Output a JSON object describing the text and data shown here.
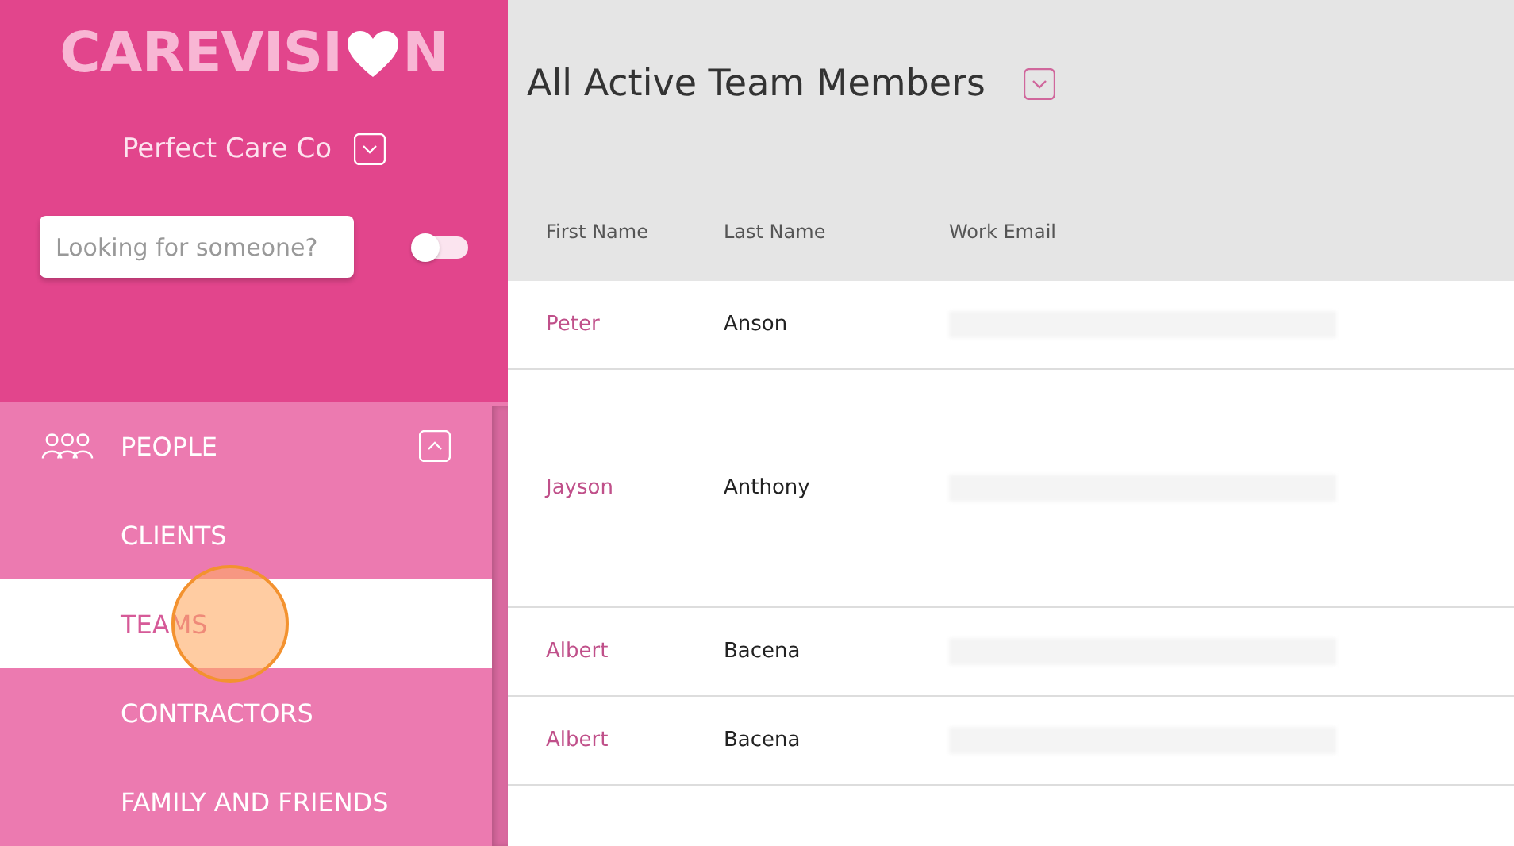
{
  "logo": {
    "text_start": "CAREVISI",
    "text_end": "N"
  },
  "organisation": {
    "name": "Perfect Care Co"
  },
  "search": {
    "placeholder": "Looking for someone?"
  },
  "toggle": {
    "on": false
  },
  "nav": [
    {
      "label": "PEOPLE",
      "expanded": true,
      "children": [
        {
          "label": "CLIENTS",
          "selected": false
        },
        {
          "label": "TEAMS",
          "selected": true
        },
        {
          "label": "CONTRACTORS",
          "selected": false
        },
        {
          "label": "FAMILY AND FRIENDS",
          "selected": false
        }
      ]
    }
  ],
  "page_title": "All Active Team Members",
  "table": {
    "columns": [
      "First Name",
      "Last Name",
      "Work Email"
    ],
    "rows": [
      {
        "first_name": "Peter",
        "last_name": "Anson",
        "tall": false
      },
      {
        "first_name": "Jayson",
        "last_name": "Anthony",
        "tall": true
      },
      {
        "first_name": "Albert",
        "last_name": "Bacena",
        "tall": false
      },
      {
        "first_name": "Albert",
        "last_name": "Bacena",
        "tall": false
      }
    ]
  }
}
